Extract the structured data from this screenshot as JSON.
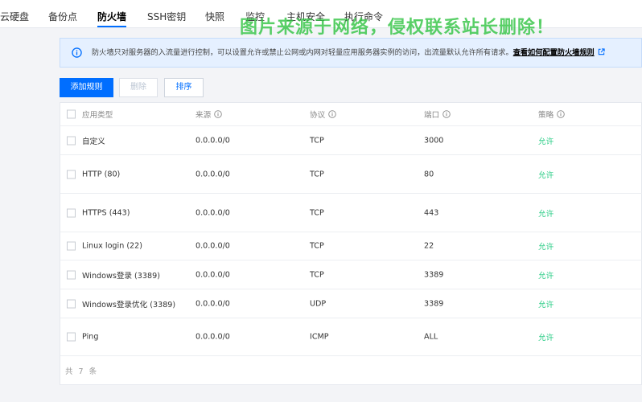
{
  "tabs": [
    "云硬盘",
    "备份点",
    "防火墙",
    "SSH密钥",
    "快照",
    "监控",
    "主机安全",
    "执行命令"
  ],
  "watermark": "图片来源于网络，侵权联系站长删除！",
  "notice": {
    "text": "防火墙只对服务器的入流量进行控制，可以设置允许或禁止公网或内网对轻量应用服务器实例的访问，出流量默认允许所有请求。",
    "link": "查看如何配置防火墙规则"
  },
  "toolbar": {
    "add": "添加规则",
    "delete": "删除",
    "sort": "排序"
  },
  "table": {
    "headers": [
      "应用类型",
      "来源",
      "协议",
      "端口",
      "策略"
    ],
    "rows": [
      [
        "自定义",
        "0.0.0.0/0",
        "TCP",
        "3000",
        "允许"
      ],
      [
        "HTTP (80)",
        "0.0.0.0/0",
        "TCP",
        "80",
        "允许"
      ],
      [
        "HTTPS (443)",
        "0.0.0.0/0",
        "TCP",
        "443",
        "允许"
      ],
      [
        "Linux login (22)",
        "0.0.0.0/0",
        "TCP",
        "22",
        "允许"
      ],
      [
        "Windows登录 (3389)",
        "0.0.0.0/0",
        "TCP",
        "3389",
        "允许"
      ],
      [
        "Windows登录优化 (3389)",
        "0.0.0.0/0",
        "UDP",
        "3389",
        "允许"
      ],
      [
        "Ping",
        "0.0.0.0/0",
        "ICMP",
        "ALL",
        "允许"
      ]
    ]
  },
  "footer": "共 7 条",
  "colors": {
    "accent": "#006eff",
    "allow": "#29cc85",
    "watermark": "#34c446"
  }
}
